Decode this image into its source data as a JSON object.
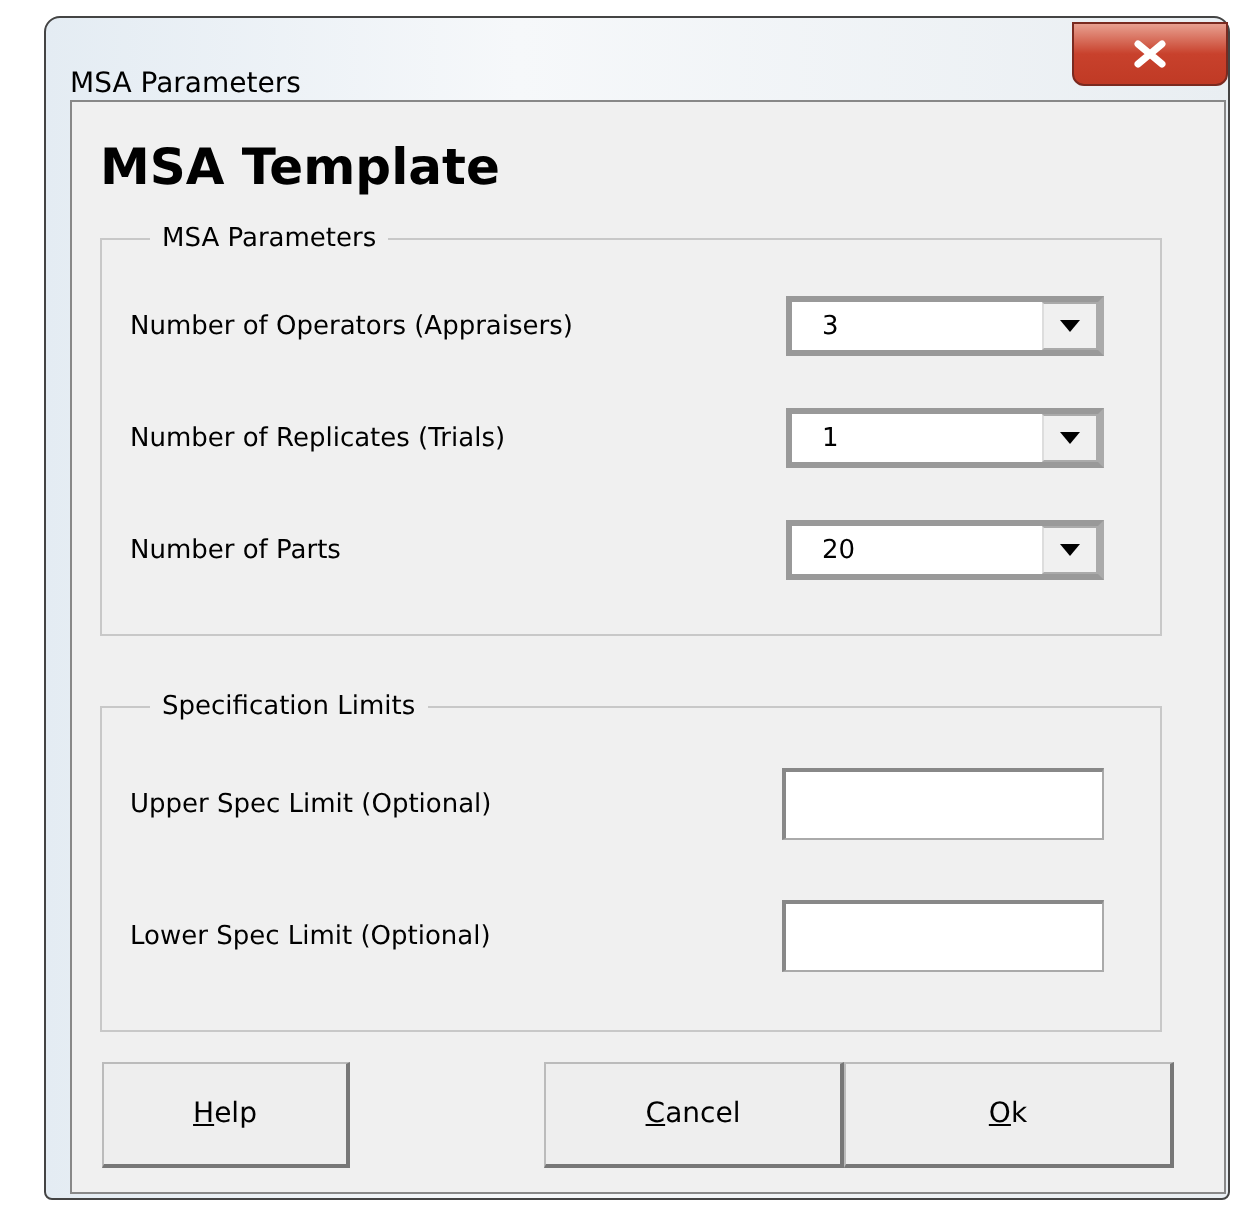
{
  "window": {
    "title": "MSA Parameters"
  },
  "heading": "MSA Template",
  "groups": [
    {
      "title": "MSA Parameters",
      "fields": [
        {
          "kind": "combo",
          "label": "Number of Operators (Appraisers)",
          "value": "3"
        },
        {
          "kind": "combo",
          "label": "Number of Replicates (Trials)",
          "value": "1"
        },
        {
          "kind": "combo",
          "label": "Number of Parts",
          "value": "20"
        }
      ]
    },
    {
      "title": "Specification Limits",
      "fields": [
        {
          "kind": "text",
          "label": "Upper Spec Limit (Optional)"
        },
        {
          "kind": "text",
          "label": "Lower Spec Limit (Optional)"
        }
      ]
    }
  ],
  "buttons": [
    {
      "label": "Help",
      "first_letter_underlined": true
    },
    {
      "label": "Cancel",
      "first_letter_underlined": true
    },
    {
      "label": "Ok",
      "first_letter_underlined": true
    }
  ]
}
